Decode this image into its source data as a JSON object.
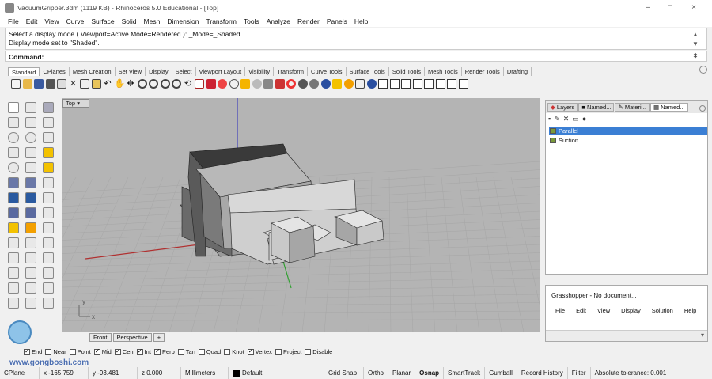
{
  "titlebar": {
    "title": "VacuumGripper.3dm (1119 KB) - Rhinoceros 5.0 Educational - [Top]",
    "minimize": "–",
    "maximize": "□",
    "close": "×"
  },
  "menu": [
    "File",
    "Edit",
    "View",
    "Curve",
    "Surface",
    "Solid",
    "Mesh",
    "Dimension",
    "Transform",
    "Tools",
    "Analyze",
    "Render",
    "Panels",
    "Help"
  ],
  "command": {
    "history_line1": "Select a display mode ( Viewport=Active  Mode=Rendered ): _Mode=_Shaded",
    "history_line2": "Display mode set to \"Shaded\".",
    "prompt": "Command:"
  },
  "toolbar_tabs": [
    "Standard",
    "CPlanes",
    "Mesh Creation",
    "Set View",
    "Display",
    "Select",
    "Viewport Layout",
    "Visibility",
    "Transform",
    "Curve Tools",
    "Surface Tools",
    "Solid Tools",
    "Mesh Tools",
    "Render Tools",
    "Drafting"
  ],
  "viewport": {
    "title": "Top",
    "axis_y": "y",
    "axis_x": "x"
  },
  "viewport_tabs": [
    "Front",
    "Perspective"
  ],
  "viewport_tab_add": "+",
  "osnaps": [
    {
      "label": "End",
      "checked": true
    },
    {
      "label": "Near",
      "checked": false
    },
    {
      "label": "Point",
      "checked": false
    },
    {
      "label": "Mid",
      "checked": true
    },
    {
      "label": "Cen",
      "checked": true
    },
    {
      "label": "Int",
      "checked": true
    },
    {
      "label": "Perp",
      "checked": true
    },
    {
      "label": "Tan",
      "checked": false
    },
    {
      "label": "Quad",
      "checked": false
    },
    {
      "label": "Knot",
      "checked": false
    },
    {
      "label": "Vertex",
      "checked": true
    },
    {
      "label": "Project",
      "checked": false
    },
    {
      "label": "Disable",
      "checked": false
    }
  ],
  "status": {
    "cplane": "CPlane",
    "x": "x -165.759",
    "y": "y -93.481",
    "z": "z 0.000",
    "units": "Millimeters",
    "layer": "Default",
    "grid_snap": "Grid Snap",
    "ortho": "Ortho",
    "planar": "Planar",
    "osnap": "Osnap",
    "smarttrack": "SmartTrack",
    "gumball": "Gumball",
    "record_history": "Record History",
    "filter": "Filter",
    "tolerance": "Absolute tolerance: 0.001"
  },
  "panel": {
    "tabs": [
      "Layers",
      "Named...",
      "Materi...",
      "Named..."
    ],
    "layers": [
      {
        "name": "Parallel",
        "selected": true,
        "color": "#7a9a3a"
      },
      {
        "name": "Suction",
        "selected": false,
        "color": "#7a9a3a"
      }
    ]
  },
  "grasshopper": {
    "title": "Grasshopper - No document...",
    "menu": [
      "File",
      "Edit",
      "View",
      "Display",
      "Solution",
      "Help"
    ]
  },
  "watermark": {
    "url": "www.gongboshi.com"
  },
  "colors": {
    "viewport_bg": "#b4b4b4",
    "grid": "#a6a6a6",
    "x_axis": "#b03030",
    "y_axis": "#30a030",
    "selected_layer": "#3b7fd4"
  }
}
